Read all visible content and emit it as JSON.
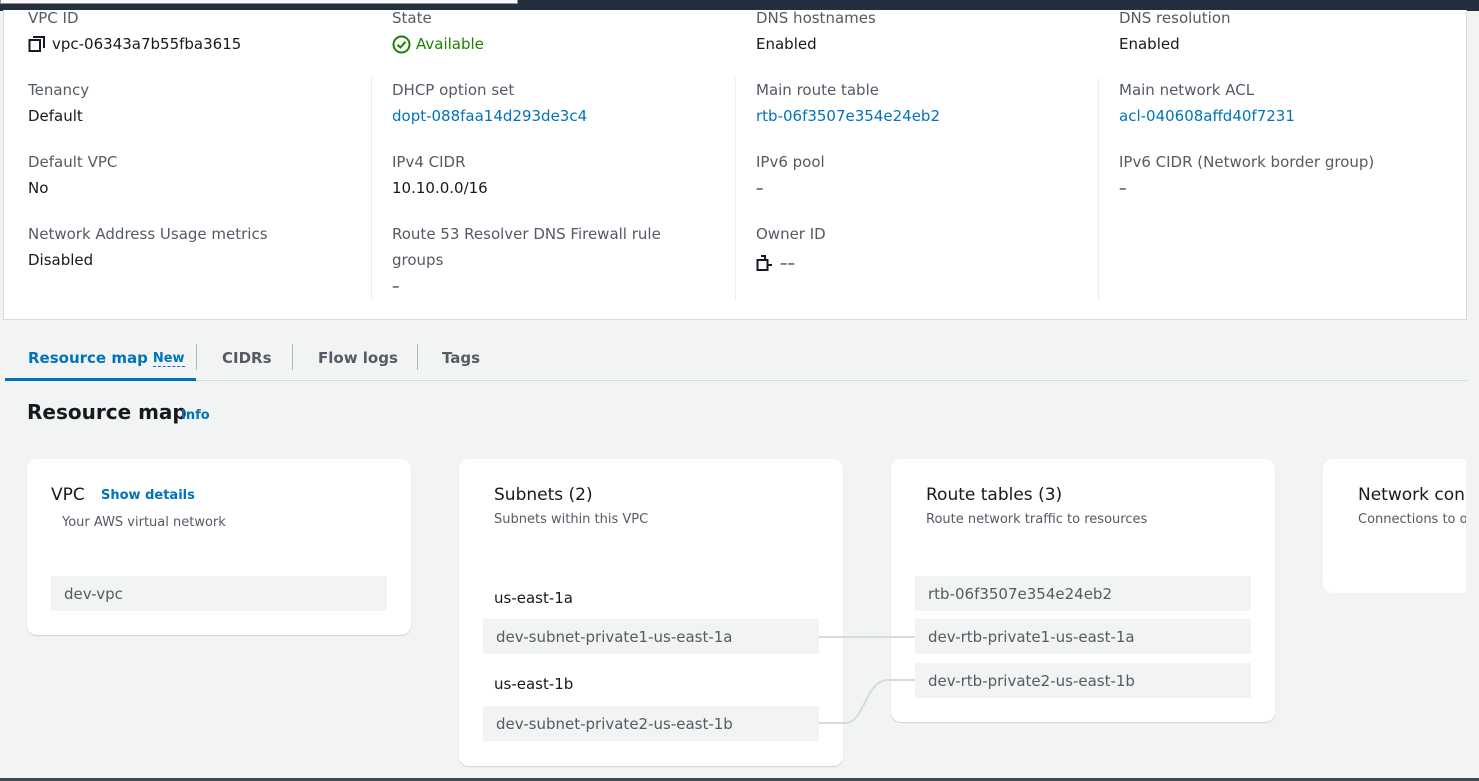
{
  "details": {
    "col1": [
      {
        "label": "VPC ID",
        "value": "vpc-06343a7b55fba3615",
        "icon": "copy-icon"
      },
      {
        "label": "Tenancy",
        "value": "Default"
      },
      {
        "label": "Default VPC",
        "value": "No"
      },
      {
        "label": "Network Address Usage metrics",
        "value": "Disabled"
      }
    ],
    "col2": [
      {
        "label": "State",
        "value": "Available",
        "icon": "check-circle-icon"
      },
      {
        "label": "DHCP option set",
        "value": "dopt-088faa14d293de3c4"
      },
      {
        "label": "IPv4 CIDR",
        "value": "10.10.0.0/16"
      },
      {
        "label": "Route 53 Resolver DNS Firewall rule groups",
        "value": "–"
      }
    ],
    "col3": [
      {
        "label": "DNS hostnames",
        "value": "Enabled"
      },
      {
        "label": "Main route table",
        "value": "rtb-06f3507e354e24eb2"
      },
      {
        "label": "IPv6 pool",
        "value": "–"
      },
      {
        "label": "Owner ID",
        "value": "––",
        "icon": "copy-icon"
      }
    ],
    "col4": [
      {
        "label": "DNS resolution",
        "value": "Enabled"
      },
      {
        "label": "Main network ACL",
        "value": "acl-040608affd40f7231"
      },
      {
        "label": "IPv6 CIDR (Network border group)",
        "value": "–"
      }
    ]
  },
  "tabs": {
    "resource_map": "Resource map",
    "new_badge": "New",
    "cidrs": "CIDRs",
    "flow_logs": "Flow logs",
    "tags": "Tags"
  },
  "resource_map": {
    "title": "Resource map",
    "info": "Info",
    "vpc_card": {
      "title": "VPC",
      "show_details": "Show details",
      "subtitle": "Your AWS virtual network",
      "items": [
        "dev-vpc"
      ]
    },
    "subnets_card": {
      "title": "Subnets (2)",
      "subtitle": "Subnets within this VPC",
      "az1": "us-east-1a",
      "subnet1": "dev-subnet-private1-us-east-1a",
      "az2": "us-east-1b",
      "subnet2": "dev-subnet-private2-us-east-1b"
    },
    "route_tables_card": {
      "title": "Route tables (3)",
      "subtitle": "Route network traffic to resources",
      "items": [
        "rtb-06f3507e354e24eb2",
        "dev-rtb-private1-us-east-1a",
        "dev-rtb-private2-us-east-1b"
      ]
    },
    "network_card": {
      "title": "Network con",
      "subtitle": "Connections to o"
    }
  },
  "colors": {
    "link": "#0073bb",
    "success": "#1d8102",
    "text": "#16191f",
    "secondary": "#545b64",
    "page_bg": "#f2f3f3",
    "header_bg": "#232f3e"
  }
}
